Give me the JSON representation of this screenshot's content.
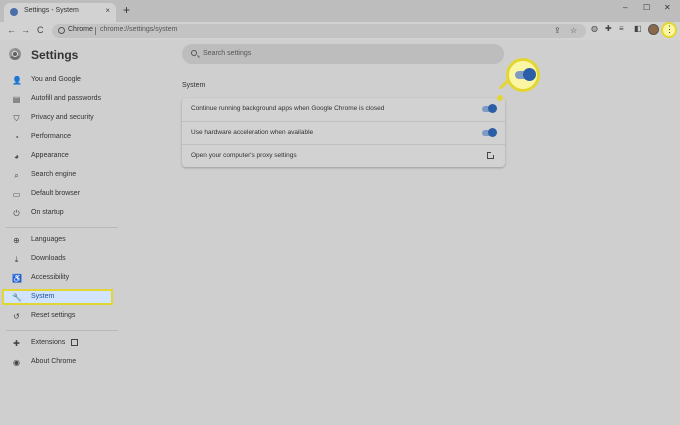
{
  "browser": {
    "tab_title": "Settings - System",
    "tab_close": "×",
    "new_tab": "+",
    "window_controls": [
      "–",
      "☐",
      "✕"
    ],
    "nav": {
      "back": "←",
      "forward": "→",
      "reload": "C"
    },
    "omnibox": {
      "site_label": "Chrome",
      "url": "chrome://settings/system"
    },
    "menu_icon": "⋮"
  },
  "settings": {
    "title": "Settings",
    "search_placeholder": "Search settings"
  },
  "sidebar": {
    "items": [
      {
        "label": "You and Google",
        "icon": "person-icon",
        "glyph": "👤"
      },
      {
        "label": "Autofill and passwords",
        "icon": "autofill-icon",
        "glyph": "▤"
      },
      {
        "label": "Privacy and security",
        "icon": "shield-icon",
        "glyph": "⛉"
      },
      {
        "label": "Performance",
        "icon": "performance-icon",
        "glyph": "◔"
      },
      {
        "label": "Appearance",
        "icon": "palette-icon",
        "glyph": "◕"
      },
      {
        "label": "Search engine",
        "icon": "search-icon",
        "glyph": "⌕"
      },
      {
        "label": "Default browser",
        "icon": "browser-icon",
        "glyph": "▭"
      },
      {
        "label": "On startup",
        "icon": "power-icon",
        "glyph": "⏻"
      },
      {
        "label": "Languages",
        "icon": "globe-icon",
        "glyph": "⊕"
      },
      {
        "label": "Downloads",
        "icon": "download-icon",
        "glyph": "⤓"
      },
      {
        "label": "Accessibility",
        "icon": "accessibility-icon",
        "glyph": "♿"
      },
      {
        "label": "System",
        "icon": "wrench-icon",
        "glyph": "🔧"
      },
      {
        "label": "Reset settings",
        "icon": "reset-icon",
        "glyph": "↺"
      },
      {
        "label": "Extensions",
        "icon": "puzzle-icon",
        "glyph": "✚"
      },
      {
        "label": "About Chrome",
        "icon": "chrome-icon",
        "glyph": "◉"
      }
    ],
    "active": "System"
  },
  "system": {
    "section_title": "System",
    "rows": [
      {
        "label": "Continue running background apps when Google Chrome is closed",
        "control": "toggle",
        "state": "on"
      },
      {
        "label": "Use hardware acceleration when available",
        "control": "toggle",
        "state": "on"
      },
      {
        "label": "Open your computer's proxy settings",
        "control": "external-link"
      }
    ]
  },
  "colors": {
    "highlight": "#e2d632",
    "toggle_on": "#2c5ea8",
    "active_nav_bg": "#d2e3fc"
  }
}
